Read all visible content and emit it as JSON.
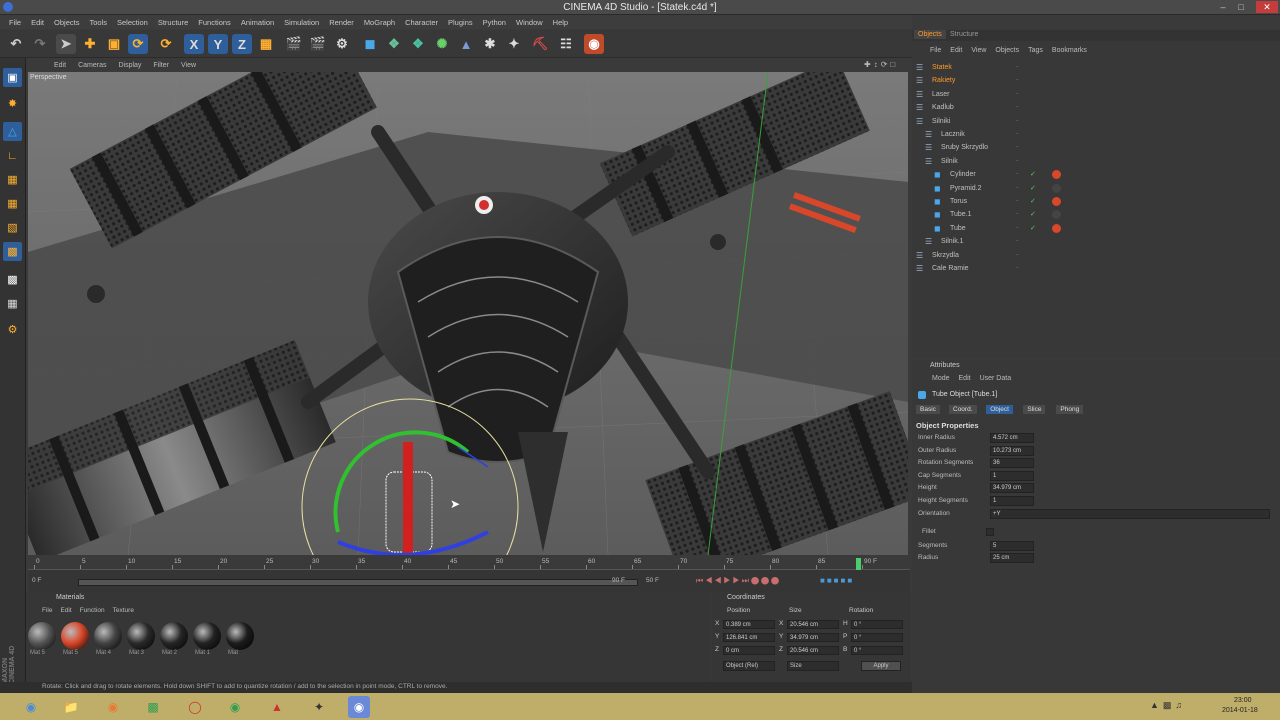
{
  "window": {
    "title": "CINEMA 4D Studio - [Statek.c4d *]"
  },
  "menu": [
    "File",
    "Edit",
    "Objects",
    "Tools",
    "Selection",
    "Structure",
    "Functions",
    "Animation",
    "Simulation",
    "Render",
    "MoGraph",
    "Character",
    "Plugins",
    "Python",
    "Window",
    "Help"
  ],
  "viewport": {
    "menu": [
      "Edit",
      "Cameras",
      "Display",
      "Filter",
      "View"
    ],
    "label": "Perspective"
  },
  "timeline": {
    "ticks": [
      "0",
      "5",
      "10",
      "15",
      "20",
      "25",
      "30",
      "35",
      "40",
      "45",
      "50",
      "55",
      "60",
      "65",
      "70",
      "75",
      "80",
      "85",
      "90 F"
    ],
    "start_frame": "0 F",
    "end_frame": "90 F",
    "cur_left": "0 F",
    "cur_right": "90 F",
    "cur_mid": "50 F"
  },
  "materials": {
    "header": "Materials",
    "menu": [
      "File",
      "Edit",
      "Function",
      "Texture"
    ],
    "items": [
      {
        "label": "Mat 5",
        "color": "#555"
      },
      {
        "label": "Mat 5",
        "color": "#d8472a"
      },
      {
        "label": "Mat 4",
        "color": "#444"
      },
      {
        "label": "Mat 3",
        "color": "#2a2a2a"
      },
      {
        "label": "Mat 2",
        "color": "#252525"
      },
      {
        "label": "Mat 1",
        "color": "#222"
      },
      {
        "label": "Mat",
        "color": "#1c1c1c"
      }
    ]
  },
  "coordinates": {
    "header": "Coordinates",
    "col_position": "Position",
    "col_size": "Size",
    "col_rotation": "Rotation",
    "rows": [
      {
        "axis": "X",
        "pos": "0.389 cm",
        "size_axis": "X",
        "size": "20.546 cm",
        "rot_axis": "H",
        "rot": "0 °"
      },
      {
        "axis": "Y",
        "pos": "126.841 cm",
        "size_axis": "Y",
        "size": "34.979 cm",
        "rot_axis": "P",
        "rot": "0 °"
      },
      {
        "axis": "Z",
        "pos": "0 cm",
        "size_axis": "Z",
        "size": "20.546 cm",
        "rot_axis": "B",
        "rot": "0 °"
      }
    ],
    "mode_select": "Object (Rel)",
    "size_select": "Size",
    "apply_button": "Apply"
  },
  "status": {
    "text": "Rotate: Click and drag to rotate elements. Hold down SHIFT to add to quantize rotation / add to the selection in point mode, CTRL to remove."
  },
  "object_manager": {
    "tabs": [
      "Objects",
      "Structure"
    ],
    "menu": [
      "File",
      "Edit",
      "View",
      "Objects",
      "Tags",
      "Bookmarks"
    ],
    "rows": [
      {
        "name": "Statek",
        "indent": 0,
        "color": "#ff9a2a"
      },
      {
        "name": "Rakiety",
        "indent": 0,
        "color": "#ff9a2a"
      },
      {
        "name": "Laser",
        "indent": 0,
        "color": "#c0c0c0"
      },
      {
        "name": "Kadlub",
        "indent": 0,
        "color": "#c0c0c0"
      },
      {
        "name": "Silniki",
        "indent": 0,
        "color": "#c0c0c0"
      },
      {
        "name": "Lacznik",
        "indent": 1,
        "color": "#c0c0c0"
      },
      {
        "name": "Sruby Skrzydlo",
        "indent": 1,
        "color": "#c0c0c0"
      },
      {
        "name": "Silnik",
        "indent": 1,
        "color": "#c0c0c0"
      },
      {
        "name": "Cylinder",
        "indent": 2,
        "color": "#c0c0c0"
      },
      {
        "name": "Pyramid.2",
        "indent": 2,
        "color": "#c0c0c0"
      },
      {
        "name": "Torus",
        "indent": 2,
        "color": "#c0c0c0"
      },
      {
        "name": "Tube.1",
        "indent": 2,
        "color": "#c0c0c0"
      },
      {
        "name": "Tube",
        "indent": 2,
        "color": "#c0c0c0"
      },
      {
        "name": "Silnik.1",
        "indent": 1,
        "color": "#c0c0c0"
      },
      {
        "name": "Skrzydla",
        "indent": 0,
        "color": "#c0c0c0"
      },
      {
        "name": "Cale Ramie",
        "indent": 0,
        "color": "#c0c0c0"
      }
    ]
  },
  "attributes": {
    "header": "Attributes",
    "menu": [
      "Mode",
      "Edit",
      "User Data"
    ],
    "object_title": "Tube Object [Tube.1]",
    "tabs": [
      "Basic",
      "Coord.",
      "Object",
      "Slice",
      "Phong"
    ],
    "active_tab": "Object",
    "section": "Object Properties",
    "fields": [
      {
        "label": "Inner Radius",
        "value": "4.572 cm"
      },
      {
        "label": "Outer Radius",
        "value": "10.273 cm"
      },
      {
        "label": "Rotation Segments",
        "value": "36"
      },
      {
        "label": "Cap Segments",
        "value": "1"
      },
      {
        "label": "Height",
        "value": "34.979 cm"
      },
      {
        "label": "Height Segments",
        "value": "1"
      },
      {
        "label": "Orientation",
        "value": "+Y"
      }
    ],
    "fillet": "Fillet",
    "fillet_fields": [
      {
        "label": "Segments",
        "value": "5"
      },
      {
        "label": "Radius",
        "value": "25 cm"
      }
    ]
  },
  "taskbar": {
    "time": "23:00",
    "date": "2014-01-18"
  }
}
